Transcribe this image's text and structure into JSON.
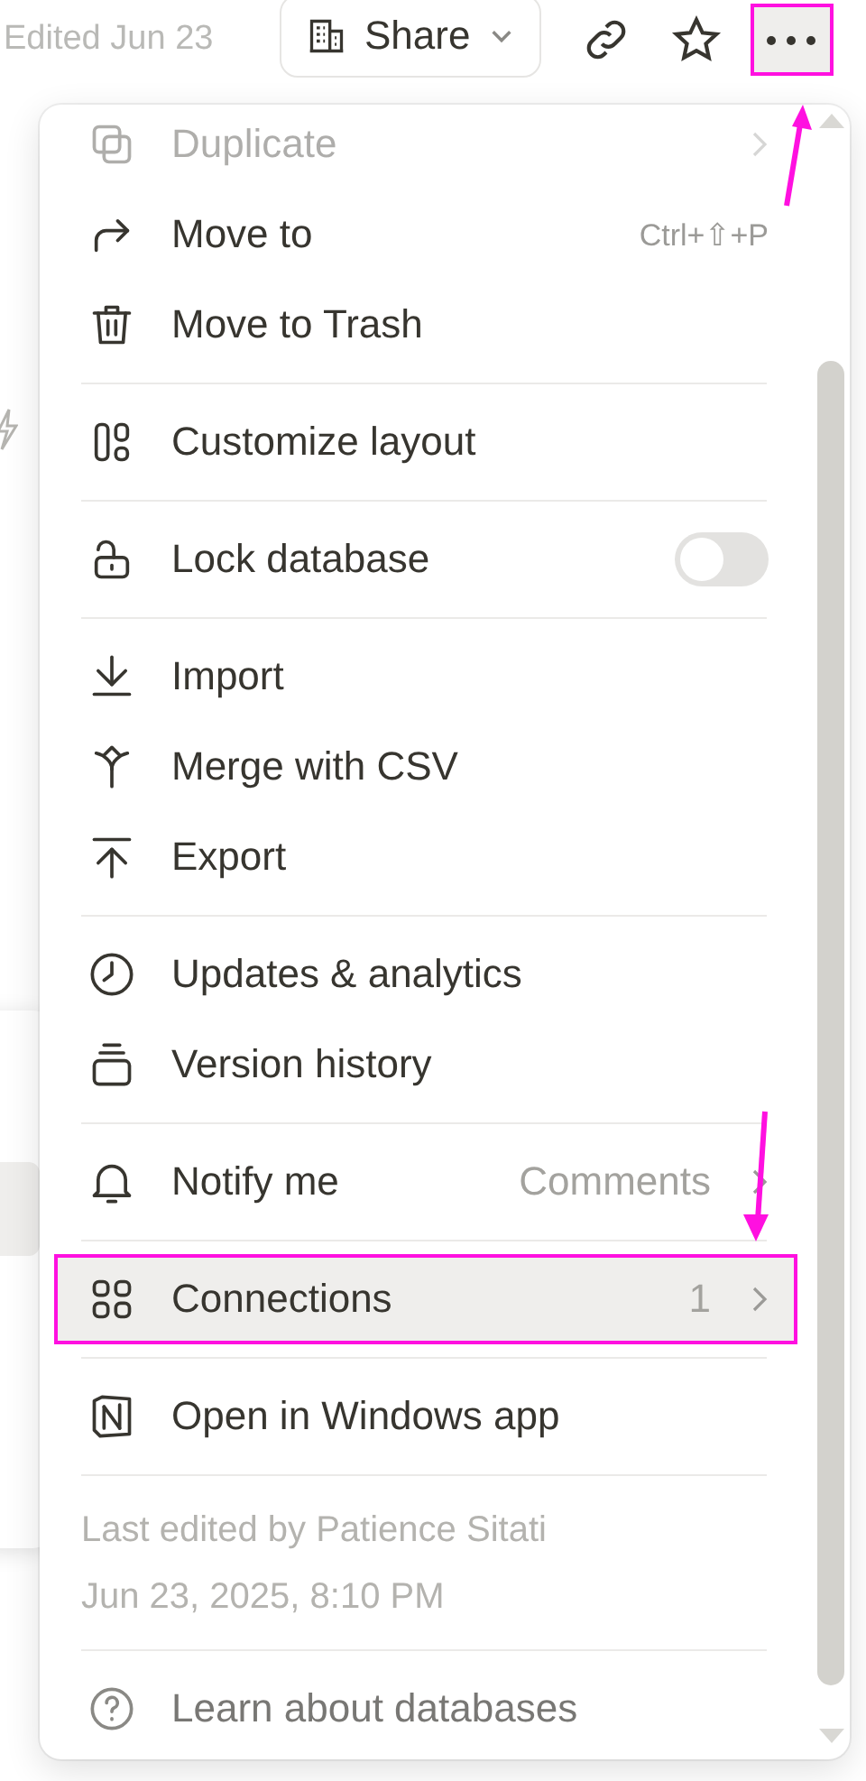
{
  "header": {
    "edited": "Edited Jun 23",
    "share_button": {
      "label": "Share"
    },
    "more_button": {
      "highlighted": true
    }
  },
  "menu": {
    "sections": [
      {
        "kind": "items",
        "items": [
          {
            "label": "Duplicate",
            "submenu": true,
            "selected": false,
            "highlighted": false
          },
          {
            "label": "Move to",
            "shortcut": "Ctrl+⇧+P",
            "selected": false,
            "highlighted": false
          },
          {
            "label": "Move to Trash",
            "selected": false,
            "highlighted": false
          }
        ]
      },
      {
        "kind": "items",
        "items": [
          {
            "label": "Customize layout",
            "selected": false,
            "highlighted": false
          }
        ]
      },
      {
        "kind": "items",
        "items": [
          {
            "label": "Lock database",
            "toggle": {
              "on": false
            },
            "selected": false,
            "highlighted": false
          }
        ]
      },
      {
        "kind": "items",
        "items": [
          {
            "label": "Import",
            "selected": false,
            "highlighted": false
          },
          {
            "label": "Merge with CSV",
            "selected": false,
            "highlighted": false
          },
          {
            "label": "Export",
            "selected": false,
            "highlighted": false
          }
        ]
      },
      {
        "kind": "items",
        "items": [
          {
            "label": "Updates & analytics",
            "selected": false,
            "highlighted": false
          },
          {
            "label": "Version history",
            "selected": false,
            "highlighted": false
          }
        ]
      },
      {
        "kind": "items",
        "items": [
          {
            "label": "Notify me",
            "value": "Comments",
            "submenu": true,
            "selected": false,
            "highlighted": false
          }
        ]
      },
      {
        "kind": "items",
        "items": [
          {
            "label": "Connections",
            "count": "1",
            "submenu": true,
            "selected": true,
            "highlighted": true
          }
        ]
      },
      {
        "kind": "items",
        "items": [
          {
            "label": "Open in Windows app",
            "selected": false,
            "highlighted": false
          }
        ]
      },
      {
        "kind": "info",
        "lines": [
          "Last edited by Patience Sitati",
          "Jun 23, 2025, 8:10 PM"
        ]
      },
      {
        "kind": "items",
        "items": [
          {
            "label": "Learn about databases",
            "muted": true,
            "selected": false,
            "highlighted": false
          }
        ]
      }
    ]
  }
}
